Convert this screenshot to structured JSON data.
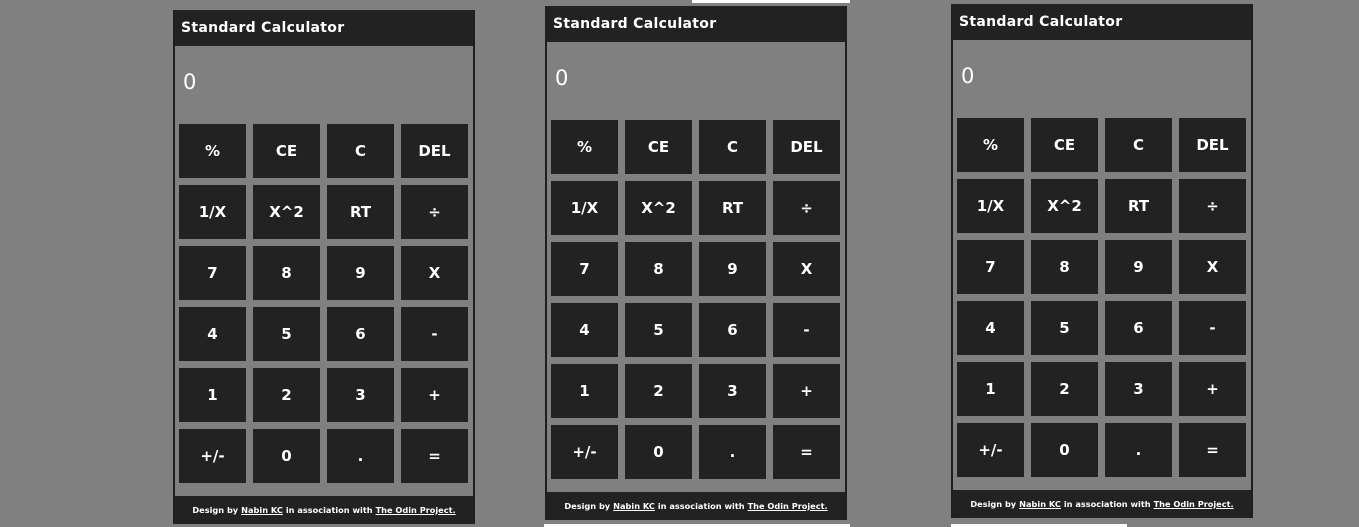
{
  "colors": {
    "page_background": "#808080",
    "panel_dark": "#222222",
    "text": "#ffffff"
  },
  "calculators": [
    {
      "title": "Standard Calculator",
      "display": "0",
      "keys": [
        "%",
        "CE",
        "C",
        "DEL",
        "1/X",
        "X^2",
        "RT",
        "÷",
        "7",
        "8",
        "9",
        "X",
        "4",
        "5",
        "6",
        "-",
        "1",
        "2",
        "3",
        "+",
        "+/-",
        "0",
        ".",
        "="
      ],
      "footer": {
        "prefix": "Design by",
        "author": "Nabin KC",
        "middle": "in association with",
        "project": "The Odin Project."
      }
    },
    {
      "title": "Standard Calculator",
      "display": "0",
      "keys": [
        "%",
        "CE",
        "C",
        "DEL",
        "1/X",
        "X^2",
        "RT",
        "÷",
        "7",
        "8",
        "9",
        "X",
        "4",
        "5",
        "6",
        "-",
        "1",
        "2",
        "3",
        "+",
        "+/-",
        "0",
        ".",
        "="
      ],
      "footer": {
        "prefix": "Design by",
        "author": "Nabin KC",
        "middle": "in association with",
        "project": "The Odin Project."
      }
    },
    {
      "title": "Standard Calculator",
      "display": "0",
      "keys": [
        "%",
        "CE",
        "C",
        "DEL",
        "1/X",
        "X^2",
        "RT",
        "÷",
        "7",
        "8",
        "9",
        "X",
        "4",
        "5",
        "6",
        "-",
        "1",
        "2",
        "3",
        "+",
        "+/-",
        "0",
        ".",
        "="
      ],
      "footer": {
        "prefix": "Design by",
        "author": "Nabin KC",
        "middle": "in association with",
        "project": "The Odin Project."
      }
    }
  ]
}
